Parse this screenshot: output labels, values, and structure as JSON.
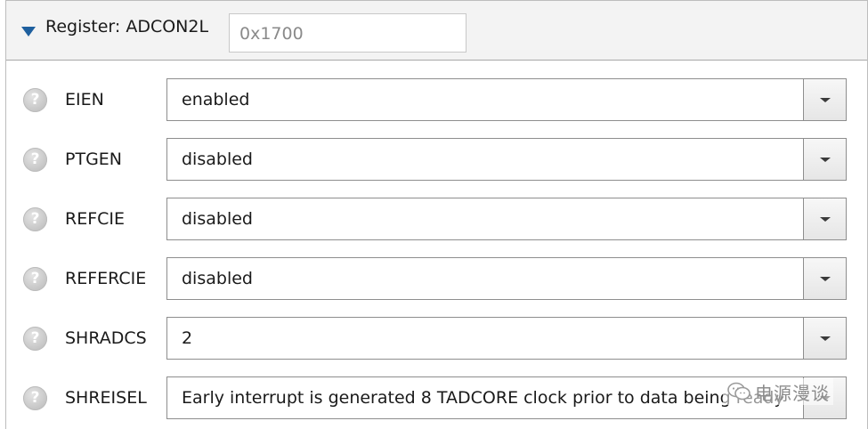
{
  "header": {
    "title": "Register: ADCON2L",
    "address": "0x1700",
    "expanded": true
  },
  "fields": [
    {
      "label": "EIEN",
      "value": "enabled",
      "help_icon": "help-icon"
    },
    {
      "label": "PTGEN",
      "value": "disabled",
      "help_icon": "help-icon"
    },
    {
      "label": "REFCIE",
      "value": "disabled",
      "help_icon": "help-icon"
    },
    {
      "label": "REFERCIE",
      "value": "disabled",
      "help_icon": "help-icon"
    },
    {
      "label": "SHRADCS",
      "value": "2",
      "help_icon": "help-icon"
    },
    {
      "label": "SHREISEL",
      "value": "Early interrupt is generated 8 TADCORE clock prior to data being ready",
      "help_icon": "help-icon"
    }
  ],
  "watermark": {
    "text": "电源漫谈",
    "icon": "wechat-icon"
  },
  "colors": {
    "header_bg": "#f3f3f3",
    "accent_arrow": "#1e5f9e",
    "border": "#8e8e8e"
  }
}
